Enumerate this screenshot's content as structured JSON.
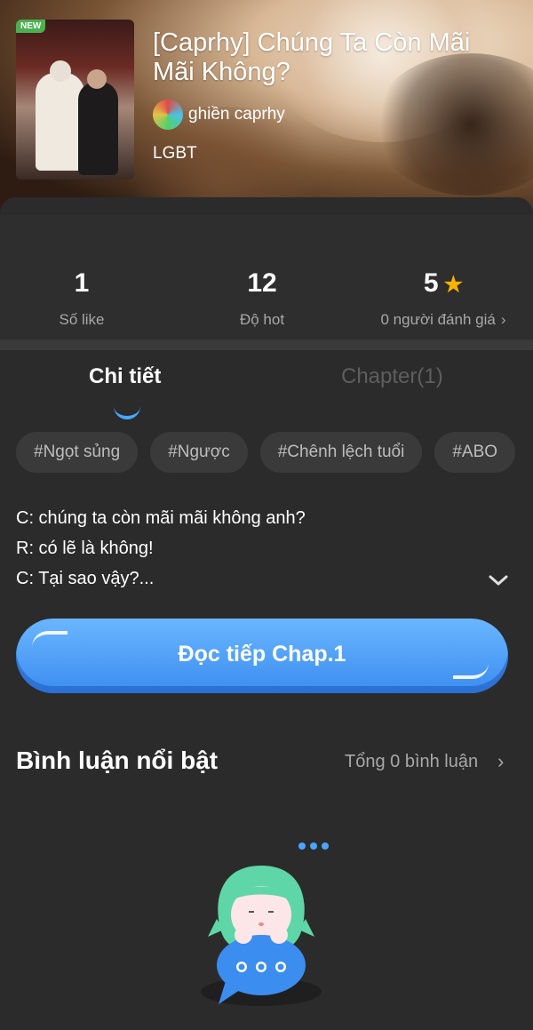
{
  "header": {
    "badge": "NEW",
    "title": "[Caprhy] Chúng Ta Còn Mãi Mãi Không?",
    "author": "ghiền caprhy",
    "genre": "LGBT"
  },
  "stats": {
    "likes": {
      "value": "1",
      "label": "Số like"
    },
    "hot": {
      "value": "12",
      "label": "Độ hot"
    },
    "rating": {
      "value": "5",
      "label": "0 người đánh giá"
    }
  },
  "tabs": {
    "details": "Chi tiết",
    "chapters": "Chapter(1)"
  },
  "tags": [
    "#Ngọt sủng",
    "#Ngược",
    "#Chênh lệch tuổi",
    "#ABO"
  ],
  "description": {
    "line1": "C: chúng ta còn mãi mãi không anh?",
    "line2": "R: có lẽ là không!",
    "line3": "C: Tại sao vậy?..."
  },
  "read_button": "Đọc tiếp Chap.1",
  "comments": {
    "title": "Bình luận nổi bật",
    "total": "Tổng 0 bình luận"
  },
  "colors": {
    "accent": "#47a7ff",
    "star": "#f7b500",
    "background": "#2b2b2b"
  }
}
